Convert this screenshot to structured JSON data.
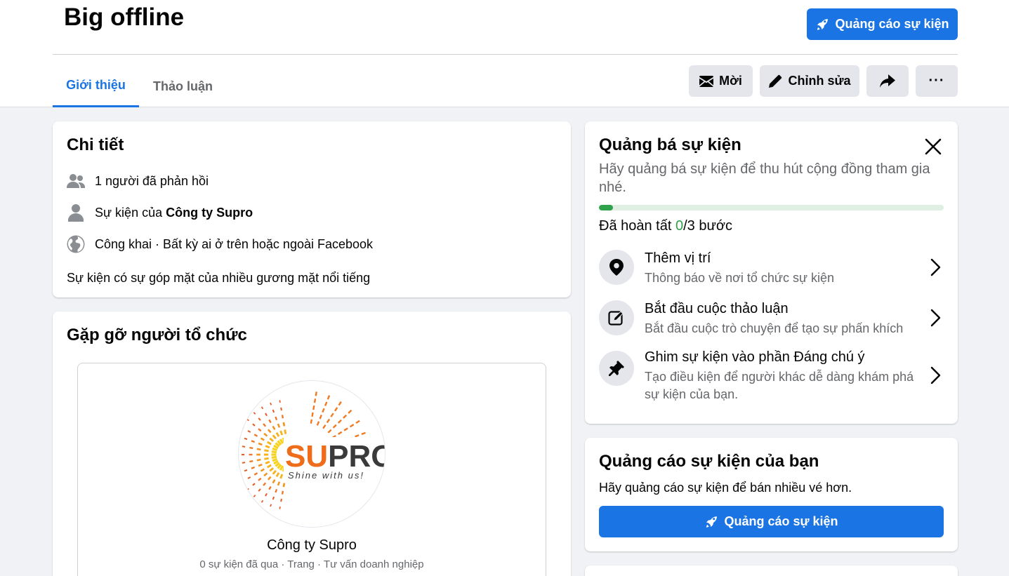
{
  "event": {
    "title": "Big offline"
  },
  "header": {
    "promote_label": "Quảng cáo sự kiện",
    "tabs": [
      {
        "label": "Giới thiệu"
      },
      {
        "label": "Thảo luận"
      }
    ],
    "invite_label": "Mời",
    "edit_label": "Chỉnh sửa",
    "more_label": "···"
  },
  "details": {
    "title": "Chi tiết",
    "responses": "1 người đã phản hồi",
    "host_prefix": "Sự kiện của ",
    "host_name": "Công ty Supro",
    "privacy": "Công khai · Bất kỳ ai ở trên hoặc ngoài Facebook",
    "description": "Sự kiện có sự góp mặt của nhiều gương mặt nổi tiếng"
  },
  "organizer": {
    "title": "Gặp gỡ người tổ chức",
    "logo_text_su": "SU",
    "logo_text_pro": "PRO",
    "logo_tagline": "Shine with us!",
    "name": "Công ty Supro",
    "meta": "0 sự kiện đã qua · Trang · Tư vấn doanh nghiệp"
  },
  "promote_event": {
    "title": "Quảng bá sự kiện",
    "subtitle": "Hãy quảng bá sự kiện để thu hút cộng đồng tham gia nhé.",
    "progress_prefix": "Đã hoàn tất ",
    "progress_done": "0",
    "progress_total": "/3 bước",
    "progress_fraction": 0.04,
    "steps": [
      {
        "title": "Thêm vị trí",
        "desc": "Thông báo về nơi tổ chức sự kiện",
        "icon": "location-pin-icon"
      },
      {
        "title": "Bắt đầu cuộc thảo luận",
        "desc": "Bắt đầu cuộc trò chuyện để tạo sự phấn khích",
        "icon": "compose-icon"
      },
      {
        "title": "Ghim sự kiện vào phần Đáng chú ý",
        "desc": "Tạo điều kiện để người khác dễ dàng khám phá sự kiện của bạn.",
        "icon": "pin-icon"
      }
    ],
    "colors": {
      "progress": "#31a24c",
      "track": "#e0efe4"
    }
  },
  "ads": {
    "title": "Quảng cáo sự kiện của bạn",
    "subtitle": "Hãy quảng cáo sự kiện để bán nhiều vé hơn.",
    "button_label": "Quảng cáo sự kiện"
  },
  "colors": {
    "accent": "#1b74e4",
    "background": "#f0f2f5"
  }
}
